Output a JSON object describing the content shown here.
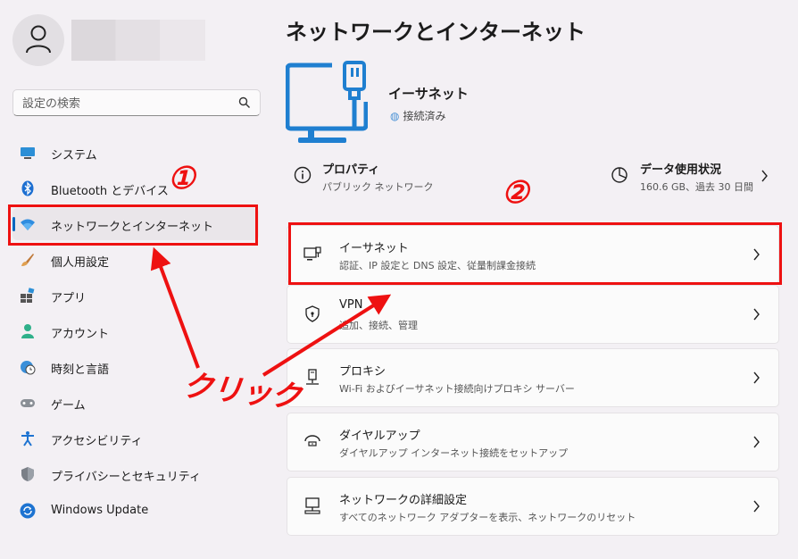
{
  "search": {
    "placeholder": "設定の検索"
  },
  "sidebar": {
    "items": [
      {
        "label": "システム",
        "icon": "monitor-icon"
      },
      {
        "label": "Bluetooth とデバイス",
        "icon": "bluetooth-icon"
      },
      {
        "label": "ネットワークとインターネット",
        "icon": "wifi-icon",
        "active": true
      },
      {
        "label": "個人用設定",
        "icon": "brush-icon"
      },
      {
        "label": "アプリ",
        "icon": "apps-icon"
      },
      {
        "label": "アカウント",
        "icon": "person-icon"
      },
      {
        "label": "時刻と言語",
        "icon": "globe-clock-icon"
      },
      {
        "label": "ゲーム",
        "icon": "gamepad-icon"
      },
      {
        "label": "アクセシビリティ",
        "icon": "accessibility-icon"
      },
      {
        "label": "プライバシーとセキュリティ",
        "icon": "shield-icon"
      },
      {
        "label": "Windows Update",
        "icon": "update-icon"
      }
    ]
  },
  "main": {
    "title": "ネットワークとインターネット",
    "connection": {
      "name": "イーサネット",
      "status": "接続済み"
    },
    "properties": {
      "title": "プロパティ",
      "subtitle": "パブリック ネットワーク"
    },
    "data_usage": {
      "title": "データ使用状況",
      "subtitle": "160.6 GB、過去 30 日間"
    },
    "cards": [
      {
        "title": "イーサネット",
        "subtitle": "認証、IP 設定と DNS 設定、従量制課金接続",
        "icon": "ethernet-icon"
      },
      {
        "title": "VPN",
        "subtitle": "追加、接続、管理",
        "icon": "vpn-shield-icon"
      },
      {
        "title": "プロキシ",
        "subtitle": "Wi-Fi およびイーサネット接続向けプロキシ サーバー",
        "icon": "proxy-icon"
      },
      {
        "title": "ダイヤルアップ",
        "subtitle": "ダイヤルアップ インターネット接続をセットアップ",
        "icon": "dialup-icon"
      },
      {
        "title": "ネットワークの詳細設定",
        "subtitle": "すべてのネットワーク アダプターを表示、ネットワークのリセット",
        "icon": "network-adapter-icon"
      }
    ]
  },
  "annotations": {
    "step1": "①",
    "step2": "②",
    "click": "クリック",
    "color": "#ee1111"
  },
  "colors": {
    "accent": "#0067c0"
  }
}
